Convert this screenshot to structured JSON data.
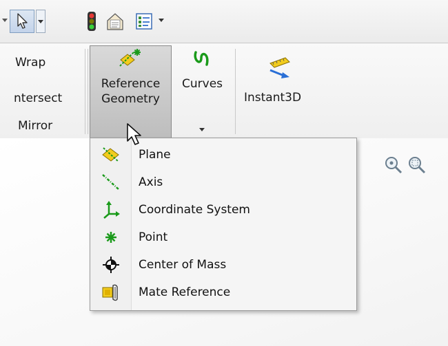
{
  "ribbon": {
    "wrap": "Wrap",
    "intersect": "ntersect",
    "mirror": "Mirror",
    "reference_line1": "Reference",
    "reference_line2": "Geometry",
    "curves": "Curves",
    "instant3d": "Instant3D"
  },
  "flyout": {
    "items": [
      {
        "label": "Plane",
        "icon": "plane-icon"
      },
      {
        "label": "Axis",
        "icon": "axis-icon"
      },
      {
        "label": "Coordinate System",
        "icon": "coordinate-system-icon"
      },
      {
        "label": "Point",
        "icon": "point-icon"
      },
      {
        "label": "Center of Mass",
        "icon": "center-of-mass-icon"
      },
      {
        "label": "Mate Reference",
        "icon": "mate-reference-icon"
      }
    ]
  },
  "colors": {
    "ribbon_pressed": "#c8c8c8",
    "icon_green": "#1a9a1a",
    "icon_yellow": "#f2cc1d",
    "selection_blue": "#2a6fd6"
  }
}
